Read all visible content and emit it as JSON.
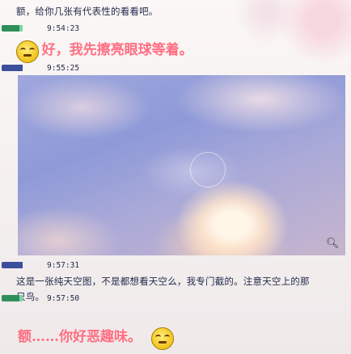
{
  "messages": [
    {
      "text": "额，给你几张有代表性的看看吧。"
    },
    {
      "time": "9:54:23",
      "text": "好，我先擦亮眼球等着。"
    },
    {
      "time": "9:55:25"
    },
    {
      "time": "9:57:31",
      "text_line1": "这是一张纯天空图，不是都想看天空么，我专门截的。注意天空上的那",
      "text_line2": "只鸟。"
    },
    {
      "time": "9:57:50",
      "text": "额……你好恶趣味。"
    }
  ],
  "icons": {
    "emoji": "smiley-face-icon",
    "emoji2": "smirk-face-icon",
    "zoom": "magnifier-icon"
  }
}
